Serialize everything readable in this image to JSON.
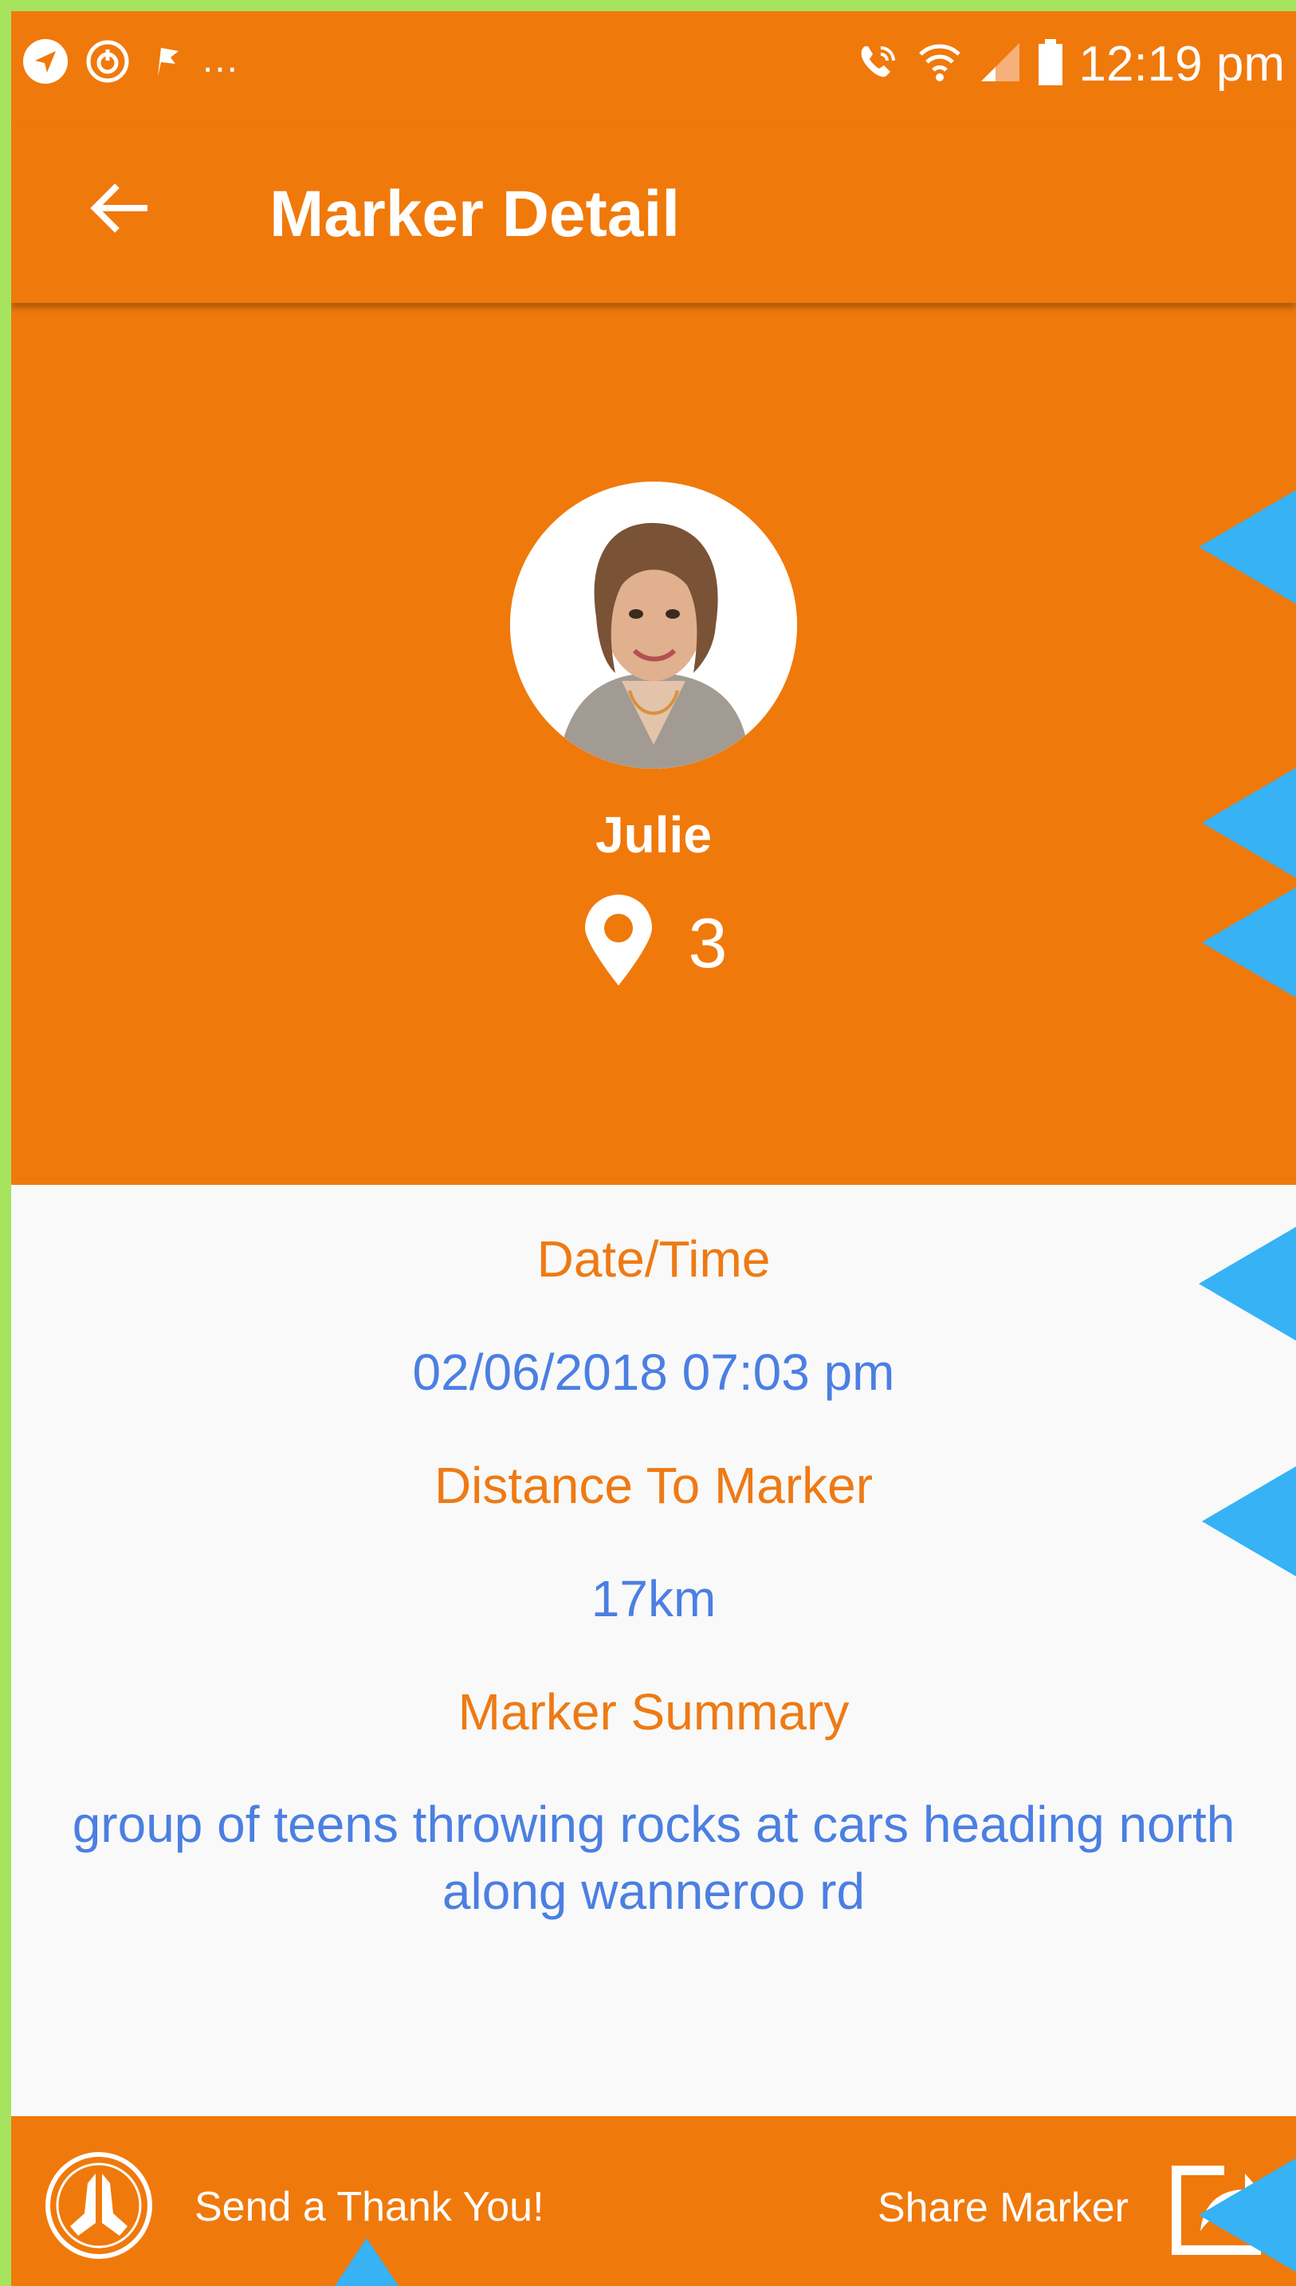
{
  "status_bar": {
    "left_icons": [
      "navigation-arrow-icon",
      "sync-icon",
      "flag-icon"
    ],
    "overflow": "...",
    "right_icons": [
      "wifi-call-icon",
      "wifi-icon",
      "signal-icon",
      "battery-icon"
    ],
    "time": "12:19 pm"
  },
  "app_bar": {
    "back_icon": "arrow-back-icon",
    "title": "Marker Detail"
  },
  "profile": {
    "name": "Julie",
    "marker_icon": "location-pin-icon",
    "marker_count": "3"
  },
  "details": {
    "datetime_label": "Date/Time",
    "datetime_value": "02/06/2018 07:03 pm",
    "distance_label": "Distance To Marker",
    "distance_value": "17km",
    "summary_label": "Marker Summary",
    "summary_value": "group of teens throwing rocks at cars heading north along wanneroo rd"
  },
  "bottom_bar": {
    "thanks_icon": "praying-hands-icon",
    "thanks_label": "Send a Thank You!",
    "share_label": "Share Marker",
    "share_icon": "share-icon"
  },
  "colors": {
    "primary": "#f0790b",
    "label_orange": "#ee7a14",
    "value_blue": "#4b7fe2",
    "background": "#f9f9f9",
    "annotation": "#36b2f5",
    "frame": "#a6e35f"
  }
}
